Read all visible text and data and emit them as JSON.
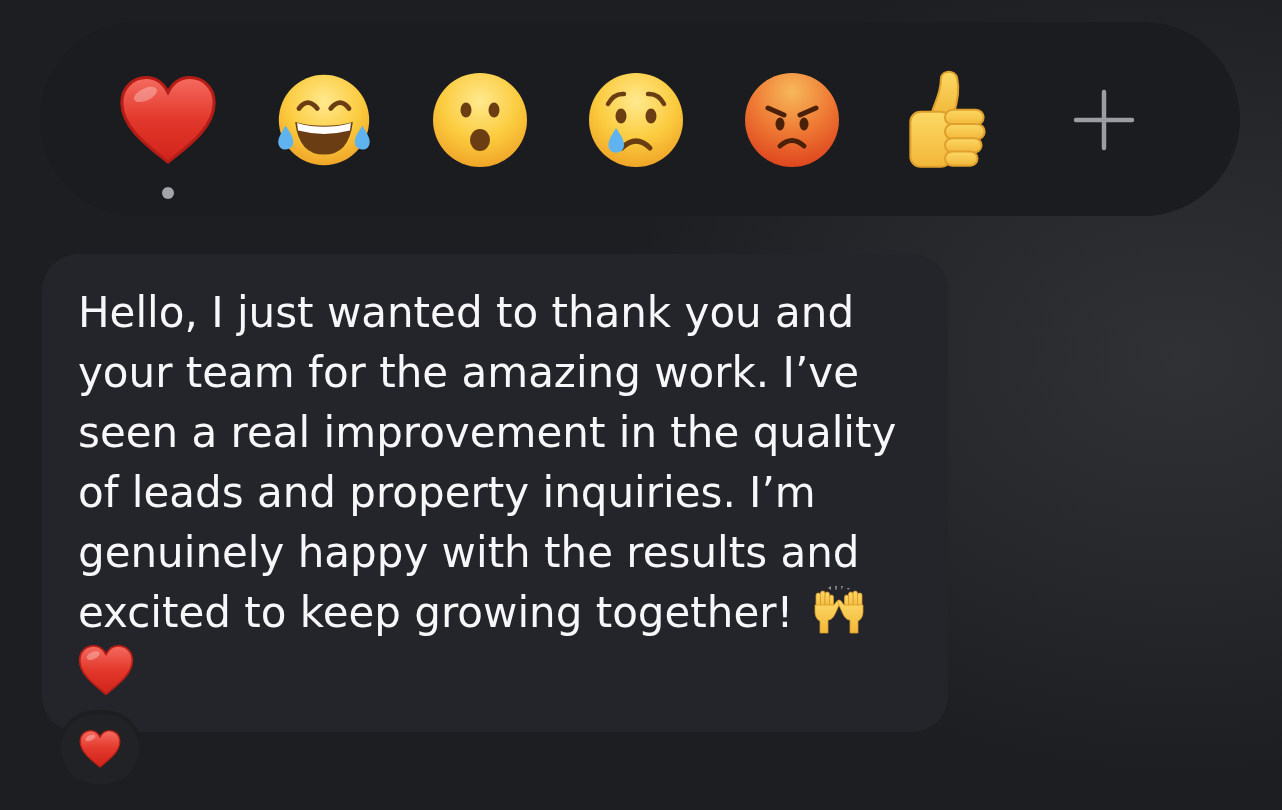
{
  "reaction_bar": {
    "reactions": [
      {
        "kind": "heart",
        "selected": true
      },
      {
        "kind": "tears-of-joy",
        "selected": false
      },
      {
        "kind": "surprised",
        "selected": false
      },
      {
        "kind": "crying",
        "selected": false
      },
      {
        "kind": "angry",
        "selected": false
      },
      {
        "kind": "thumbs-up",
        "selected": false
      }
    ]
  },
  "message": {
    "lines": [
      "Hello, I just wanted to thank you and",
      "your team for the amazing work. I’ve",
      "seen a real improvement in the quality",
      "of leads and property inquiries. I’m",
      "genuinely happy with the results and",
      "excited to keep growing together!"
    ],
    "emoji_rows": [
      [
        {
          "kind": "raised-hands"
        }
      ],
      [
        {
          "kind": "heart"
        }
      ]
    ],
    "reaction": {
      "kind": "heart"
    }
  }
}
